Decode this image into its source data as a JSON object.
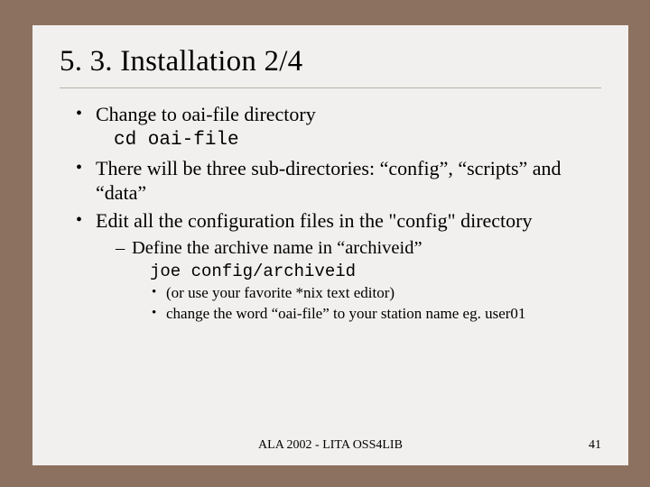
{
  "title": "5. 3. Installation 2/4",
  "bullets": {
    "b1": "Change to oai-file directory",
    "b1_code": "cd oai-file",
    "b2": "There will be three sub-directories: “config”, “scripts” and “data”",
    "b3": "Edit all the configuration files in the \"config\" directory",
    "b3_sub1": "Define the archive name in “archiveid”",
    "b3_sub1_code": "joe config/archiveid",
    "b3_sub1_a": "(or use your favorite *nix text editor)",
    "b3_sub1_b": "change the word “oai-file” to your station name eg. user01"
  },
  "footer": {
    "center": "ALA 2002 - LITA OSS4LIB",
    "page": "41"
  }
}
